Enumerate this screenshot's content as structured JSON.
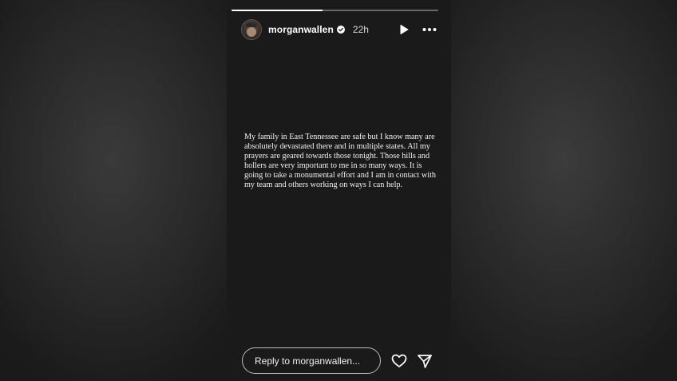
{
  "story": {
    "username": "morganwallen",
    "time": "22h",
    "progress": 0.44,
    "caption": "My family in East Tennessee are safe but I know many are absolutely devastated there and in multiple states. All my prayers are geared towards those tonight. Those hills and hollers are very important to me in so many ways. It is going to take a monumental effort and I am in contact with my team and others working on ways I can help.",
    "reply_placeholder": "Reply to morganwallen..."
  },
  "icons": {
    "verified": "verified-badge-icon",
    "play": "play-icon",
    "more": "more-options-icon",
    "heart": "heart-icon",
    "send": "send-icon"
  }
}
